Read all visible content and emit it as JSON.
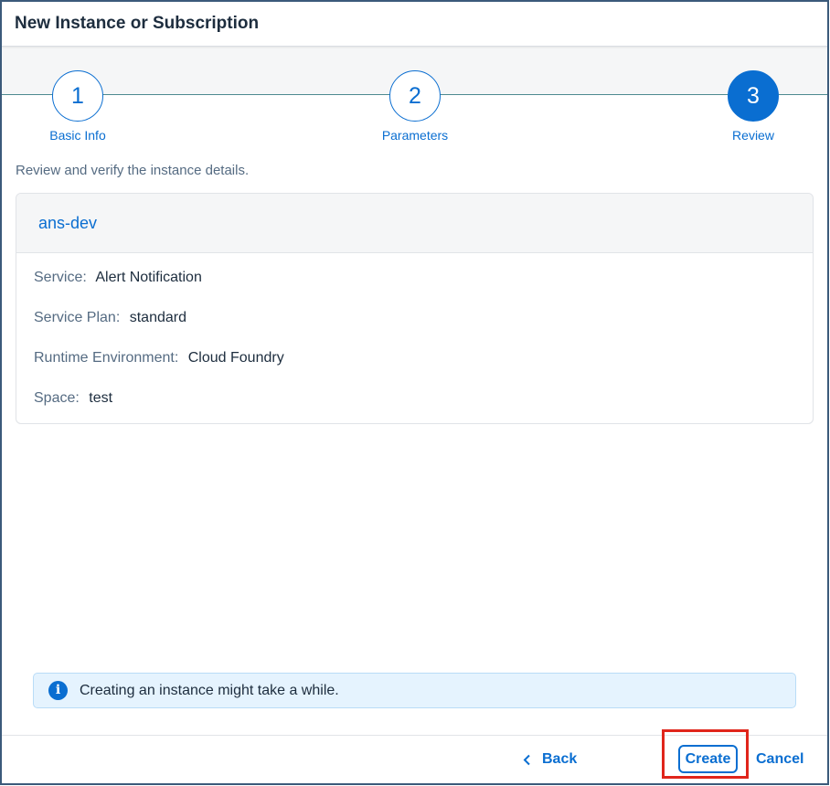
{
  "dialog": {
    "title": "New Instance or Subscription"
  },
  "wizard": {
    "steps": [
      {
        "number": "1",
        "label": "Basic Info",
        "state": "completed"
      },
      {
        "number": "2",
        "label": "Parameters",
        "state": "completed"
      },
      {
        "number": "3",
        "label": "Review",
        "state": "active"
      }
    ]
  },
  "review": {
    "intro": "Review and verify the instance details.",
    "instance_name": "ans-dev",
    "fields": [
      {
        "label": "Service:",
        "value": "Alert Notification"
      },
      {
        "label": "Service Plan:",
        "value": "standard"
      },
      {
        "label": "Runtime Environment:",
        "value": "Cloud Foundry"
      },
      {
        "label": "Space:",
        "value": "test"
      }
    ]
  },
  "info": {
    "icon": "info-icon",
    "text": "Creating an instance might take a while."
  },
  "footer": {
    "back_label": "Back",
    "create_label": "Create",
    "cancel_label": "Cancel"
  },
  "colors": {
    "accent": "#0a6ed1",
    "highlight": "#e0251b",
    "info_background": "#e5f3fe",
    "text": "#1d2d3e",
    "muted_text": "#556b82"
  }
}
